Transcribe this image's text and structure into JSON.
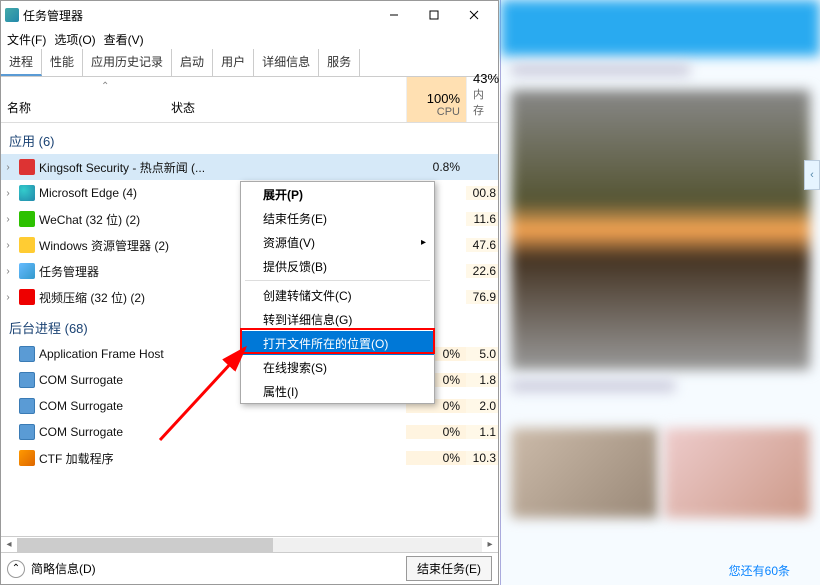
{
  "title": "任务管理器",
  "menus": {
    "file": "文件(F)",
    "options": "选项(O)",
    "view": "查看(V)"
  },
  "tabs": [
    "进程",
    "性能",
    "应用历史记录",
    "启动",
    "用户",
    "详细信息",
    "服务"
  ],
  "columns": {
    "name": "名称",
    "status": "状态",
    "cpu_pct": "100%",
    "cpu_lbl": "CPU",
    "mem_pct": "43%",
    "mem_lbl": "内存"
  },
  "groups": {
    "apps": {
      "title": "应用 (6)"
    },
    "bg": {
      "title": "后台进程 (68)"
    }
  },
  "apps": [
    {
      "name": "Kingsoft Security - 热点新闻 (...",
      "cpu": "0.8%",
      "mem": "",
      "ico": "ico-red",
      "exp": "›",
      "sel": true
    },
    {
      "name": "Microsoft Edge (4)",
      "cpu": "",
      "mem": "00.8",
      "ico": "ico-edge",
      "exp": "›"
    },
    {
      "name": "WeChat (32 位) (2)",
      "cpu": "",
      "mem": "11.6",
      "ico": "ico-wechat",
      "exp": "›"
    },
    {
      "name": "Windows 资源管理器 (2)",
      "cpu": "",
      "mem": "47.6",
      "ico": "ico-explorer",
      "exp": "›"
    },
    {
      "name": "任务管理器",
      "cpu": "",
      "mem": "22.6",
      "ico": "ico-tm",
      "exp": "›"
    },
    {
      "name": "视频压缩 (32 位) (2)",
      "cpu": "",
      "mem": "76.9",
      "ico": "ico-video",
      "exp": "›"
    }
  ],
  "bg": [
    {
      "name": "Application Frame Host",
      "cpu": "0%",
      "mem": "5.0",
      "ico": "ico-bluesq"
    },
    {
      "name": "COM Surrogate",
      "cpu": "0%",
      "mem": "1.8",
      "ico": "ico-bluesq"
    },
    {
      "name": "COM Surrogate",
      "cpu": "0%",
      "mem": "2.0",
      "ico": "ico-bluesq"
    },
    {
      "name": "COM Surrogate",
      "cpu": "0%",
      "mem": "1.1",
      "ico": "ico-bluesq"
    },
    {
      "name": "CTF 加载程序",
      "cpu": "0%",
      "mem": "10.3",
      "ico": "ico-pen"
    }
  ],
  "context": [
    {
      "label": "展开(P)",
      "bold": true
    },
    {
      "label": "结束任务(E)"
    },
    {
      "label": "资源值(V)",
      "submenu": true
    },
    {
      "label": "提供反馈(B)"
    },
    {
      "sep": true
    },
    {
      "label": "创建转储文件(C)"
    },
    {
      "label": "转到详细信息(G)"
    },
    {
      "label": "打开文件所在的位置(O)",
      "highlight": true
    },
    {
      "label": "在线搜索(S)"
    },
    {
      "label": "属性(I)"
    }
  ],
  "footer": {
    "simple": "简略信息(D)",
    "end": "结束任务(E)"
  },
  "sidewin": {
    "bottom": "您还有60条"
  }
}
